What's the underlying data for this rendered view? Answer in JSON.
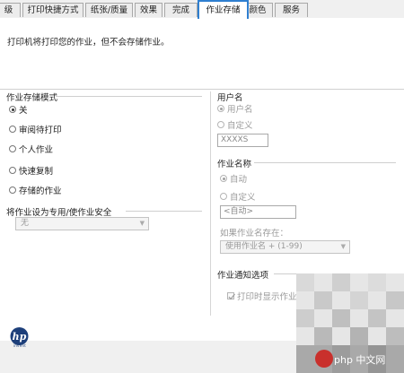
{
  "tabs": [
    {
      "label": "级",
      "active": false
    },
    {
      "label": "打印快捷方式",
      "active": false
    },
    {
      "label": "纸张/质量",
      "active": false
    },
    {
      "label": "效果",
      "active": false
    },
    {
      "label": "完成",
      "active": false
    },
    {
      "label": "作业存储",
      "active": true
    },
    {
      "label": "颜色",
      "active": false
    },
    {
      "label": "服务",
      "active": false
    }
  ],
  "description": "打印机将打印您的作业，但不会存储作业。",
  "job_storage_mode": {
    "title": "作业存储模式",
    "options": [
      {
        "label": "关",
        "selected": true
      },
      {
        "label": "审阅待打印",
        "selected": false
      },
      {
        "label": "个人作业",
        "selected": false
      },
      {
        "label": "快速复制",
        "selected": false
      },
      {
        "label": "存储的作业",
        "selected": false
      }
    ]
  },
  "private_security": {
    "title": "将作业设为专用/使作业安全",
    "value": "无"
  },
  "user_name": {
    "title": "用户名",
    "options": [
      {
        "label": "用户名",
        "selected": true
      },
      {
        "label": "自定义",
        "selected": false
      }
    ],
    "field_value": "XXXXS"
  },
  "job_name": {
    "title": "作业名称",
    "options": [
      {
        "label": "自动",
        "selected": true
      },
      {
        "label": "自定义",
        "selected": false
      }
    ],
    "field_value": "<自动>",
    "exists_label": "如果作业名存在：",
    "exists_value": "使用作业名 + (1-99)"
  },
  "notification": {
    "title": "作业通知选项",
    "checkbox_label": "打印时显示作业 ID",
    "checked": true
  },
  "logo": {
    "text": "invent"
  },
  "watermark": {
    "text": "php 中文网"
  },
  "colors": {
    "active_tab_border": "#2f7fd0",
    "logo_blue": "#1d3f7a"
  }
}
